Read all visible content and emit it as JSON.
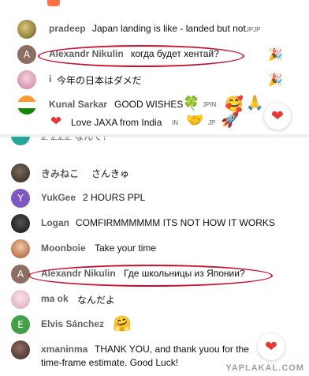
{
  "top_chat": [
    {
      "author": "pradeep",
      "message": "Japan landing is like - landed but not",
      "suffix": "JPJP"
    },
    {
      "author": "Alexandr Nikulin",
      "avatar_letter": "A",
      "message": "когда будет хентай?",
      "highlighted": true
    },
    {
      "author": "i",
      "message": "今年の日本はダメだ"
    },
    {
      "author": "Kunal Sarkar",
      "message": "GOOD WISHES",
      "badge1": "JPIN",
      "line2": "Love JAXA from India",
      "badge2": "IN",
      "badge3": "JP"
    }
  ],
  "partial_row": "ℤ ℤℤℤ なんで？",
  "bottom_chat": [
    {
      "author": "きみねこ",
      "message": "さんきゅ"
    },
    {
      "author": "YukGee",
      "message": "2 HOURS PPL"
    },
    {
      "author": "Logan",
      "message": "COMFIRMMMMMM ITS NOT HOW IT WORKS"
    },
    {
      "author": "Moonboie",
      "message": "Take your time"
    },
    {
      "author": "Alexandr Nikulin",
      "avatar_letter": "A",
      "message": "Где школьницы из Японии?",
      "highlighted": true
    },
    {
      "author": "ma ok",
      "message": "なんだよ"
    },
    {
      "author": "Elvis Sánchez",
      "avatar_letter": "E",
      "message": ""
    },
    {
      "author": "xmaninma",
      "message": "THANK YOU, and thank yuou for the",
      "line2": "time-frame estimate. Good Luck!"
    }
  ],
  "watermark": "YAPLAKAL.COM",
  "icons": {
    "heart": "heart-icon",
    "party": "party-popper-icon",
    "clover": "four-leaf-clover-icon",
    "smile_hearts": "smiling-face-with-hearts-icon",
    "pray": "folded-hands-icon",
    "handshake": "handshake-icon",
    "rocket": "rocket-icon",
    "hug": "hugging-face-icon"
  },
  "colors": {
    "highlight_oval": "#c8102e",
    "avatar_alexandr": "#8d6e63",
    "avatar_yukgee": "#7e57c2",
    "avatar_elvis": "#43a047",
    "heart": "#e53935"
  }
}
